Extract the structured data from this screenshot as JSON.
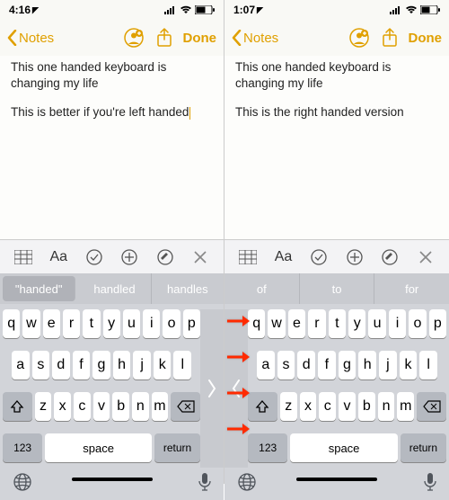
{
  "left": {
    "status_time": "4:16",
    "nav_back": "Notes",
    "nav_done": "Done",
    "note_line1": "This one handed keyboard is changing my life",
    "note_line2": "This is better if you're left handed",
    "suggestions": {
      "a": "\"handed\"",
      "b": "handled",
      "c": "handles"
    },
    "keys_r1": [
      "q",
      "w",
      "e",
      "r",
      "t",
      "y",
      "u",
      "i",
      "o",
      "p"
    ],
    "keys_r2": [
      "a",
      "s",
      "d",
      "f",
      "g",
      "h",
      "j",
      "k",
      "l"
    ],
    "keys_r3": [
      "z",
      "x",
      "c",
      "v",
      "b",
      "n",
      "m"
    ],
    "key_num": "123",
    "key_space": "space",
    "key_return": "return"
  },
  "right": {
    "status_time": "1:07",
    "nav_back": "Notes",
    "nav_done": "Done",
    "note_line1": "This one handed keyboard is changing my life",
    "note_line2": "This is the right handed version",
    "suggestions": {
      "a": "of",
      "b": "to",
      "c": "for"
    },
    "keys_r1": [
      "q",
      "w",
      "e",
      "r",
      "t",
      "y",
      "u",
      "i",
      "o",
      "p"
    ],
    "keys_r2": [
      "a",
      "s",
      "d",
      "f",
      "g",
      "h",
      "j",
      "k",
      "l"
    ],
    "keys_r3": [
      "z",
      "x",
      "c",
      "v",
      "b",
      "n",
      "m"
    ],
    "key_num": "123",
    "key_space": "space",
    "key_return": "return"
  },
  "toolbar_aa": "Aa"
}
